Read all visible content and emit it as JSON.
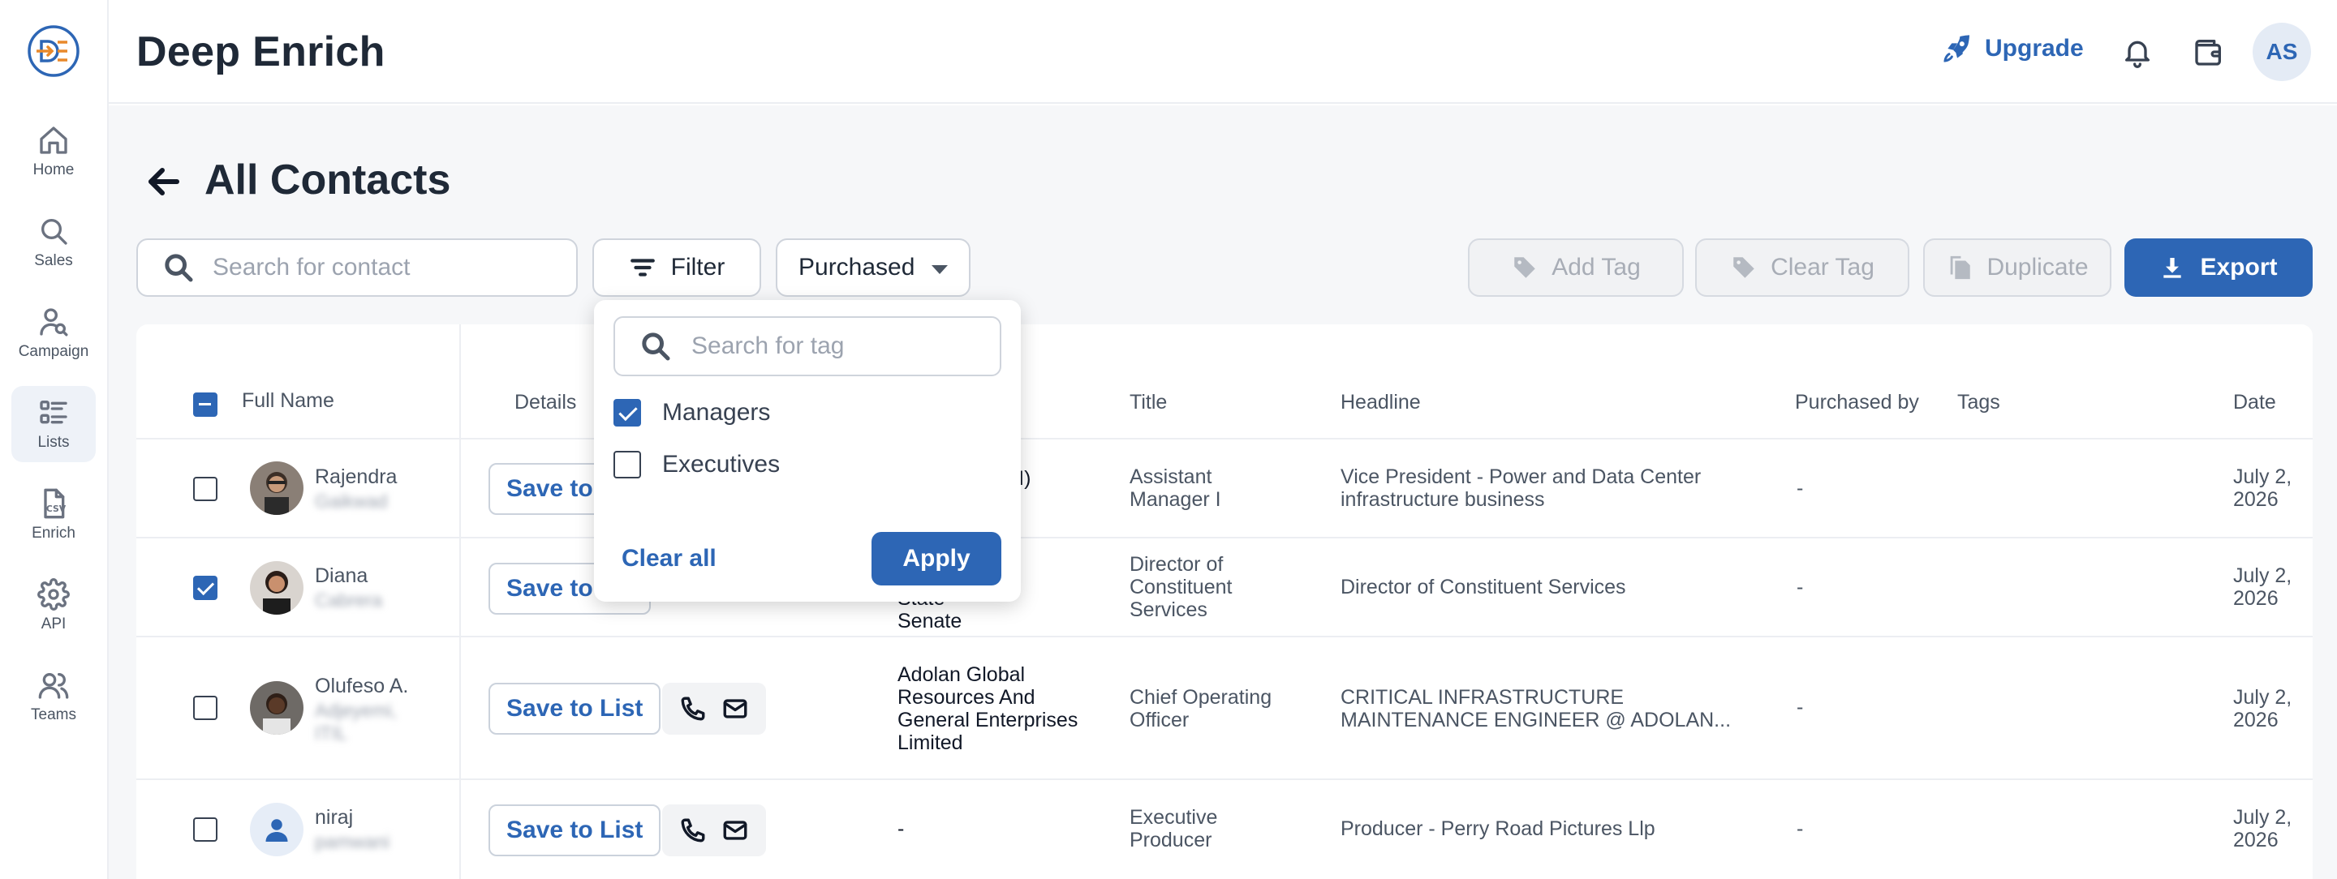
{
  "app": {
    "title": "Deep Enrich",
    "accent": "#2d66b5"
  },
  "sidebar": {
    "items": [
      {
        "label": "Home",
        "icon": "home-icon"
      },
      {
        "label": "Sales",
        "icon": "search-icon"
      },
      {
        "label": "Campaign",
        "icon": "person-search-icon"
      },
      {
        "label": "Lists",
        "icon": "list-icon",
        "active": true
      },
      {
        "label": "Enrich",
        "icon": "csv-file-icon"
      },
      {
        "label": "API",
        "icon": "gear-icon"
      },
      {
        "label": "Teams",
        "icon": "users-icon"
      }
    ]
  },
  "header": {
    "upgrade_label": "Upgrade",
    "avatar_initials": "AS"
  },
  "page": {
    "title": "All Contacts"
  },
  "toolbar": {
    "search_placeholder": "Search for contact",
    "filter_label": "Filter",
    "purchased_value": "Purchased",
    "add_tag_label": "Add Tag",
    "clear_tag_label": "Clear Tag",
    "duplicate_label": "Duplicate",
    "export_label": "Export"
  },
  "filter_dropdown": {
    "search_placeholder": "Search for tag",
    "options": [
      {
        "label": "Managers",
        "checked": true
      },
      {
        "label": "Executives",
        "checked": false
      }
    ],
    "clear_all_label": "Clear all",
    "apply_label": "Apply"
  },
  "table": {
    "headers": {
      "full_name": "Full Name",
      "details": "Details",
      "title": "Title",
      "headline": "Headline",
      "purchased_by": "Purchased by",
      "tags": "Tags",
      "date": "Date"
    },
    "save_label": "Save to List",
    "rows": [
      {
        "first": "Rajendra",
        "last": "Gaikwad",
        "checked": false,
        "company": "p (I)",
        "title_l1": "Assistant",
        "title_l2": "Manager I",
        "title_l3": "",
        "headline_l1": "Vice President - Power and Data Center",
        "headline_l2": "infrastructure business",
        "purchased_by": "-",
        "date_l1": "July 2,",
        "date_l2": "2026"
      },
      {
        "first": "Diana",
        "last": "Cabrera",
        "checked": true,
        "company_l1": "State",
        "company_l2": "Senate",
        "title_l1": "Director of",
        "title_l2": "Constituent",
        "title_l3": "Services",
        "headline_l1": "Director of Constituent Services",
        "headline_l2": "",
        "purchased_by": "-",
        "date_l1": "July 2,",
        "date_l2": "2026"
      },
      {
        "first": "Olufeso A.",
        "last_l1": "Adjeyemi,",
        "last_l2": "ITIL",
        "checked": false,
        "company_l1": "Adolan Global",
        "company_l2": "Resources And",
        "company_l3": "General Enterprises",
        "company_l4": "Limited",
        "title_l1": "Chief Operating",
        "title_l2": "Officer",
        "title_l3": "",
        "headline_l1": "CRITICAL INFRASTRUCTURE",
        "headline_l2": "MAINTENANCE ENGINEER @ ADOLAN...",
        "purchased_by": "-",
        "date_l1": "July 2,",
        "date_l2": "2026"
      },
      {
        "first": "niraj",
        "last": "pamwani",
        "checked": false,
        "company": "-",
        "title_l1": "Executive",
        "title_l2": "Producer",
        "title_l3": "",
        "headline_l1": "Producer - Perry Road Pictures Llp",
        "headline_l2": "",
        "purchased_by": "-",
        "date_l1": "July 2,",
        "date_l2": "2026"
      }
    ]
  }
}
